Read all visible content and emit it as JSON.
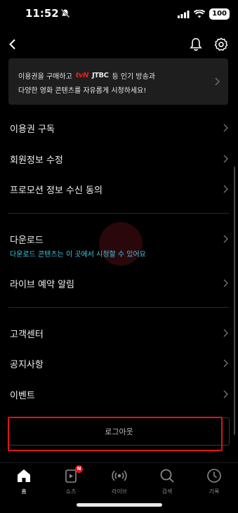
{
  "status_bar": {
    "time": "11:52",
    "battery": "100"
  },
  "banner": {
    "line1_prefix": "이용권을 구매하고",
    "logo_tvn": "tvN",
    "logo_jtbc": "JTBC",
    "line1_suffix": "등 인기 방송과",
    "line2": "다양한 영화 콘텐츠를 자유롭게 시청하세요!"
  },
  "menu": {
    "subscribe": "이용권 구독",
    "edit_profile": "회원정보 수정",
    "promo_consent": "프로모션 정보 수신 동의",
    "download": "다운로드",
    "download_sub": "다운로드 콘텐츠는 이 곳에서 시청할 수 있어요",
    "live_reminder": "라이브 예약 알림",
    "customer_center": "고객센터",
    "notices": "공지사항",
    "events": "이벤트"
  },
  "logout_label": "로그아웃",
  "bottom_nav": [
    {
      "label": "홈",
      "icon": "home-icon",
      "active": true
    },
    {
      "label": "쇼츠",
      "icon": "shorts-icon",
      "badge": "N"
    },
    {
      "label": "라이브",
      "icon": "live-icon"
    },
    {
      "label": "검색",
      "icon": "search-icon"
    },
    {
      "label": "기록",
      "icon": "history-icon"
    }
  ],
  "colors": {
    "accent_cyan": "#3fc6e0",
    "highlight_red": "#e3121b",
    "tvn_red": "#e1251b"
  }
}
